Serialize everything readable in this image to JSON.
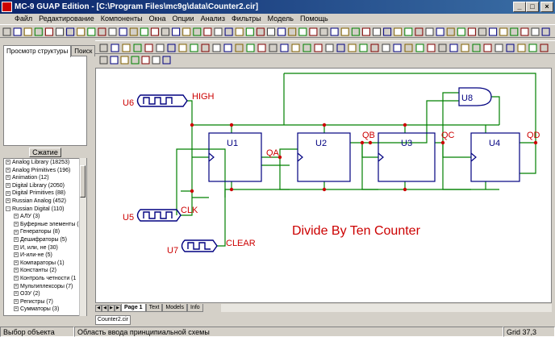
{
  "window": {
    "title": "MC-9 GUAP Edition - [C:\\Program Files\\mc9g\\data\\Counter2.cir]"
  },
  "menu": [
    "Файл",
    "Редактирование",
    "Компоненты",
    "Окна",
    "Опции",
    "Анализ",
    "Фильтры",
    "Модель",
    "Помощь"
  ],
  "left_panel": {
    "tabs": [
      "Просмотр структуры",
      "Поиск"
    ],
    "collapse_label": "Сжатие",
    "library_items": [
      {
        "label": "Analog Library (18253)",
        "expander": "+",
        "indent": 0
      },
      {
        "label": "Analog Primitives (196)",
        "expander": "+",
        "indent": 0
      },
      {
        "label": "Animation (12)",
        "expander": "+",
        "indent": 0
      },
      {
        "label": "Digital Library (2050)",
        "expander": "+",
        "indent": 0
      },
      {
        "label": "Digital Primitives (88)",
        "expander": "+",
        "indent": 0
      },
      {
        "label": "Russian Analog (452)",
        "expander": "+",
        "indent": 0
      },
      {
        "label": "Russian Digital (110)",
        "expander": "-",
        "indent": 0
      },
      {
        "label": "АЛУ (3)",
        "expander": "+",
        "indent": 1
      },
      {
        "label": "Буферные элементы (3",
        "expander": "+",
        "indent": 1
      },
      {
        "label": "Генераторы (8)",
        "expander": "+",
        "indent": 1
      },
      {
        "label": "Дешифраторы (5)",
        "expander": "+",
        "indent": 1
      },
      {
        "label": "И, или, не (30)",
        "expander": "+",
        "indent": 1
      },
      {
        "label": "И-или-не (5)",
        "expander": "+",
        "indent": 1
      },
      {
        "label": "Компараторы (1)",
        "expander": "+",
        "indent": 1
      },
      {
        "label": "Константы (2)",
        "expander": "+",
        "indent": 1
      },
      {
        "label": "Контроль четности (1",
        "expander": "+",
        "indent": 1
      },
      {
        "label": "Мультиплексоры (7)",
        "expander": "+",
        "indent": 1
      },
      {
        "label": "ОЗУ (2)",
        "expander": "+",
        "indent": 1
      },
      {
        "label": "Регистры (7)",
        "expander": "+",
        "indent": 1
      },
      {
        "label": "Сумматоры (3)",
        "expander": "+",
        "indent": 1
      }
    ]
  },
  "schematic": {
    "title_text": "Divide By Ten Counter",
    "sources": [
      "U6",
      "U5",
      "U7"
    ],
    "source_labels": [
      "HIGH",
      "CLK",
      "CLEAR"
    ],
    "counters": [
      "U1",
      "U2",
      "U3",
      "U4"
    ],
    "gate": "U8",
    "outputs": [
      "QA",
      "QB",
      "QC",
      "QD"
    ],
    "colors": {
      "wire": "#008000",
      "label": "#cc0000",
      "component": "#000080"
    }
  },
  "page_tabs": [
    "Page 1",
    "Text",
    "Models",
    "Info"
  ],
  "file_tab": "Counter2.cir",
  "status": {
    "left": "Выбор объекта",
    "middle": "Область ввода принципиальной схемы",
    "right": "Grid 37,3"
  }
}
